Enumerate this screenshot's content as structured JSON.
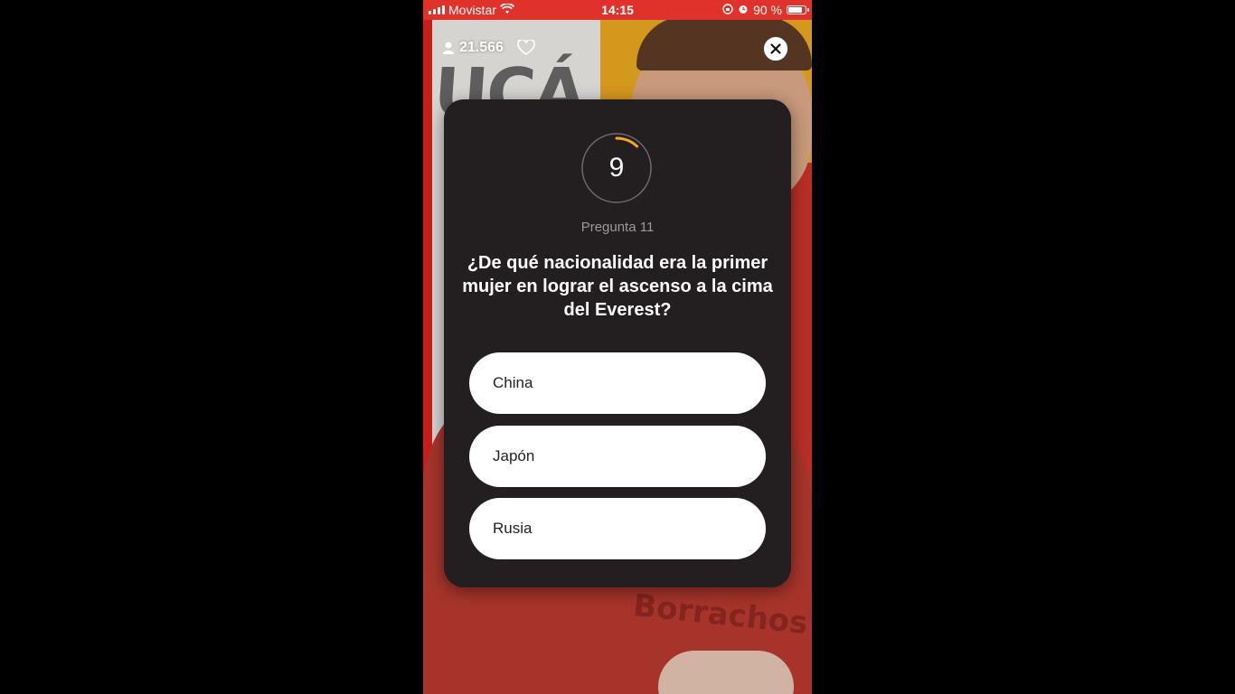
{
  "status_bar": {
    "carrier": "Movistar",
    "time": "14:15",
    "battery": "90 %",
    "battery_level": 0.9
  },
  "overlay": {
    "viewers": "21.566"
  },
  "quiz": {
    "timer_value": "9",
    "timer_progress": 0.12,
    "timer_color": "#f5a623",
    "question_number": "Pregunta 11",
    "question": "¿De qué nacionalidad era la primer mujer en lograr el ascenso a la cima del Everest?",
    "answers": [
      {
        "label": "China"
      },
      {
        "label": "Japón"
      },
      {
        "label": "Rusia"
      }
    ]
  },
  "colors": {
    "status_bar_bg": "#e0322b",
    "card_bg": "#231f20"
  },
  "icons": [
    "signal-icon",
    "wifi-icon",
    "alarm-icon",
    "lock-rotation-icon",
    "battery-icon",
    "viewer-person-icon",
    "heart-icon",
    "close-icon"
  ]
}
